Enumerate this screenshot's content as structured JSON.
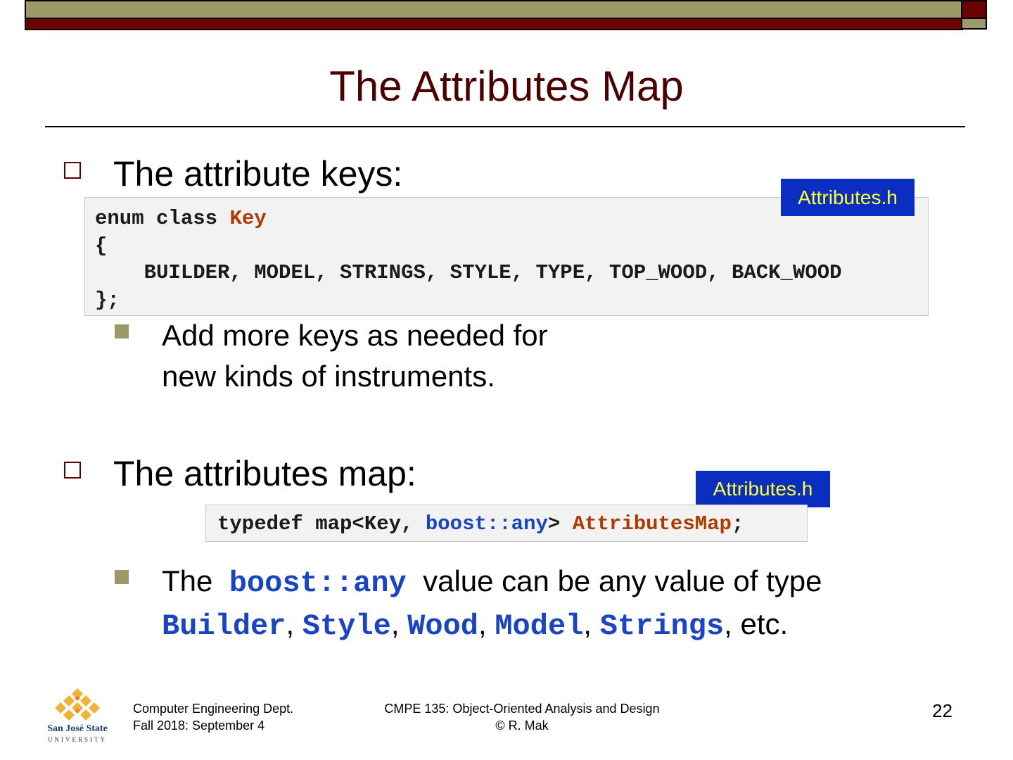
{
  "slide": {
    "title": "The Attributes Map",
    "page_number": "22"
  },
  "section1": {
    "heading": "The attribute keys:",
    "file_tag": "Attributes.h",
    "code": {
      "line1_prefix": "enum class ",
      "line1_type": "Key",
      "line2": "{",
      "line3": "    BUILDER, MODEL, STRINGS, STYLE, TYPE, TOP_WOOD, BACK_WOOD",
      "line4": "};"
    },
    "sub_bullet": {
      "line1": "Add more keys as needed for",
      "line2": "new kinds of instruments."
    }
  },
  "section2": {
    "heading": "The attributes map:",
    "file_tag": "Attributes.h",
    "code": {
      "part1": "typedef map<Key, ",
      "part2": "boost::any",
      "part3": "> ",
      "part4": "AttributesMap",
      "part5": ";"
    },
    "sub_bullet": {
      "the": "The ",
      "boost_any": "boost::any",
      "rest": " value can be any value of type",
      "types": [
        "Builder",
        "Style",
        "Wood",
        "Model",
        "Strings"
      ],
      "sep": ", ",
      "etc": ", etc."
    }
  },
  "footer": {
    "dept_line1": "Computer Engineering Dept.",
    "dept_line2": "Fall 2018: September 4",
    "course_line1": "CMPE 135: Object-Oriented Analysis and Design",
    "course_line2": "© R. Mak",
    "logo_line1": "San José State",
    "logo_line2": "UNIVERSITY"
  },
  "colors": {
    "title": "#4d0000",
    "bar_olive": "#9c9b67",
    "bar_maroon": "#6b0000",
    "tag_bg": "#0a2fc0",
    "tag_text": "#ffff33",
    "code_blue": "#1a44c8",
    "code_brown": "#b03a00"
  }
}
